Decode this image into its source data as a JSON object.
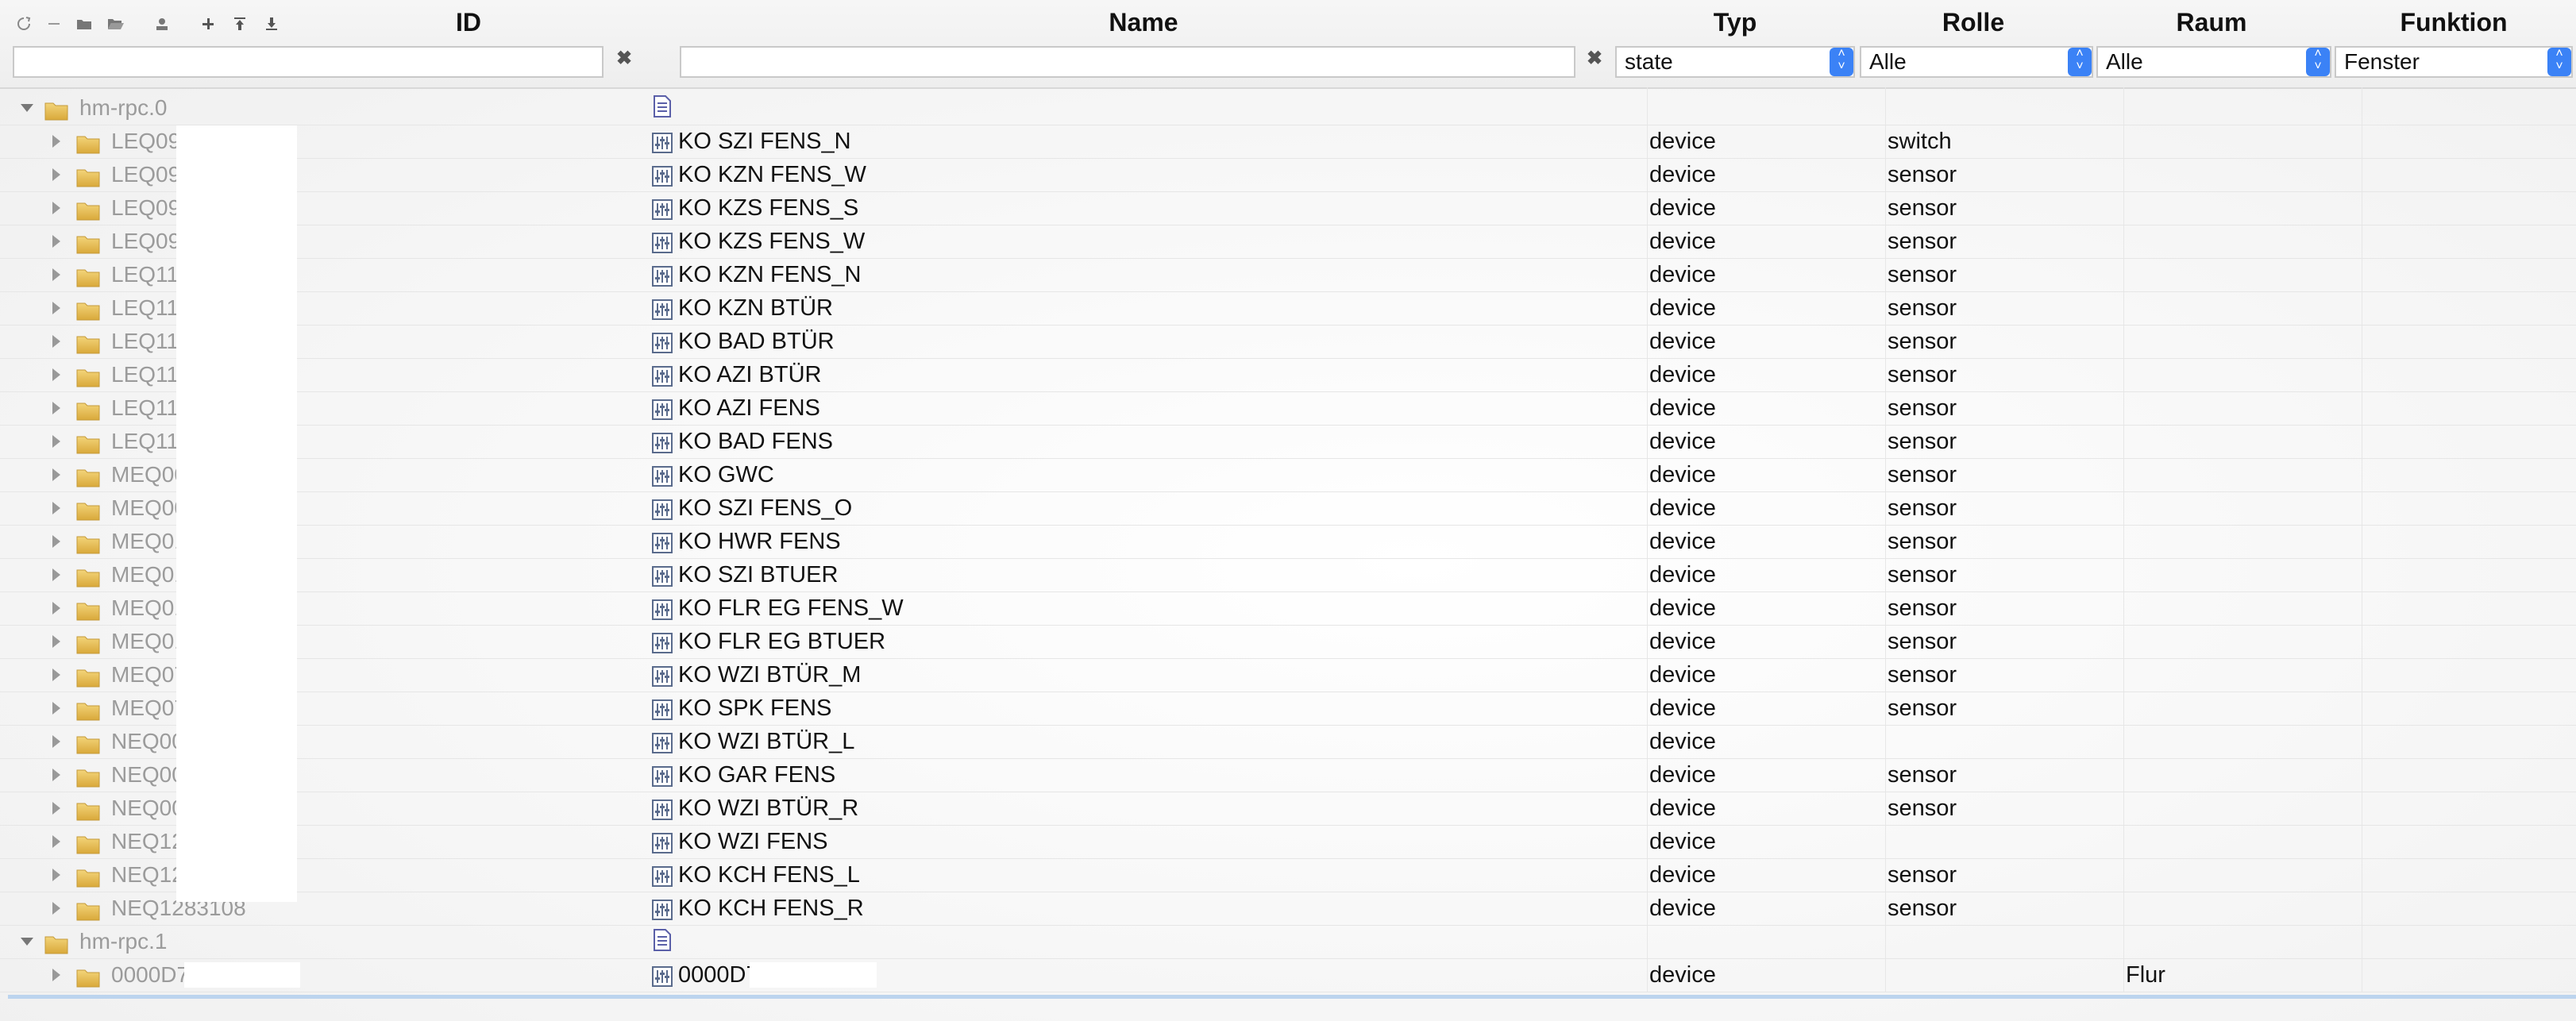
{
  "toolbar": {
    "icons": [
      "refresh-icon",
      "collapse-icon",
      "folder-closed-icon",
      "folder-open-icon",
      "user-icon",
      "add-icon",
      "upload-icon",
      "download-icon"
    ]
  },
  "columns": {
    "id": "ID",
    "name": "Name",
    "typ": "Typ",
    "rolle": "Rolle",
    "raum": "Raum",
    "funktion": "Funktion"
  },
  "filters": {
    "id_value": "",
    "name_value": "",
    "typ": "state",
    "rolle": "Alle",
    "raum": "Alle",
    "funktion": "Fenster",
    "clear_glyph": "✖"
  },
  "groups": [
    {
      "id": "hm-rpc.0",
      "rows": [
        {
          "id": "LEQ09",
          "name": "KO SZI FENS_N",
          "typ": "device",
          "role": "switch",
          "room": ""
        },
        {
          "id": "LEQ09",
          "name": "KO KZN FENS_W",
          "typ": "device",
          "role": "sensor",
          "room": ""
        },
        {
          "id": "LEQ09",
          "name": "KO KZS FENS_S",
          "typ": "device",
          "role": "sensor",
          "room": ""
        },
        {
          "id": "LEQ09",
          "name": "KO KZS FENS_W",
          "typ": "device",
          "role": "sensor",
          "room": ""
        },
        {
          "id": "LEQ11",
          "name": "KO KZN FENS_N",
          "typ": "device",
          "role": "sensor",
          "room": ""
        },
        {
          "id": "LEQ11",
          "name": "KO KZN BTÜR",
          "typ": "device",
          "role": "sensor",
          "room": ""
        },
        {
          "id": "LEQ11",
          "name": "KO BAD BTÜR",
          "typ": "device",
          "role": "sensor",
          "room": ""
        },
        {
          "id": "LEQ11",
          "name": "KO AZI BTÜR",
          "typ": "device",
          "role": "sensor",
          "room": ""
        },
        {
          "id": "LEQ11",
          "name": "KO AZI FENS",
          "typ": "device",
          "role": "sensor",
          "room": ""
        },
        {
          "id": "LEQ11",
          "name": "KO BAD FENS",
          "typ": "device",
          "role": "sensor",
          "room": ""
        },
        {
          "id": "MEQ00",
          "name": "KO GWC",
          "typ": "device",
          "role": "sensor",
          "room": ""
        },
        {
          "id": "MEQ00",
          "name": "KO SZI FENS_O",
          "typ": "device",
          "role": "sensor",
          "room": ""
        },
        {
          "id": "MEQ01",
          "name": "KO HWR FENS",
          "typ": "device",
          "role": "sensor",
          "room": ""
        },
        {
          "id": "MEQ01",
          "name": "KO SZI BTUER",
          "typ": "device",
          "role": "sensor",
          "room": ""
        },
        {
          "id": "MEQ01",
          "name": "KO FLR EG FENS_W",
          "typ": "device",
          "role": "sensor",
          "room": ""
        },
        {
          "id": "MEQ01",
          "name": "KO FLR EG BTUER",
          "typ": "device",
          "role": "sensor",
          "room": ""
        },
        {
          "id": "MEQ07",
          "name": "KO WZI BTÜR_M",
          "typ": "device",
          "role": "sensor",
          "room": ""
        },
        {
          "id": "MEQ07",
          "name": "KO SPK FENS",
          "typ": "device",
          "role": "sensor",
          "room": ""
        },
        {
          "id": "NEQ00",
          "name": "KO WZI BTÜR_L",
          "typ": "device",
          "role": "",
          "room": ""
        },
        {
          "id": "NEQ00",
          "name": "KO GAR FENS",
          "typ": "device",
          "role": "sensor",
          "room": ""
        },
        {
          "id": "NEQ00",
          "name": "KO WZI BTÜR_R",
          "typ": "device",
          "role": "sensor",
          "room": ""
        },
        {
          "id": "NEQ12",
          "name": "KO WZI FENS",
          "typ": "device",
          "role": "",
          "room": ""
        },
        {
          "id": "NEQ12",
          "name": "KO KCH FENS_L",
          "typ": "device",
          "role": "sensor",
          "room": ""
        },
        {
          "id": "NEQ1283108",
          "name": "KO KCH FENS_R",
          "typ": "device",
          "role": "sensor",
          "room": ""
        }
      ]
    },
    {
      "id": "hm-rpc.1",
      "rows": [
        {
          "id": "0000D7",
          "name": "0000D7",
          "typ": "device",
          "role": "",
          "room": "Flur"
        }
      ]
    }
  ]
}
